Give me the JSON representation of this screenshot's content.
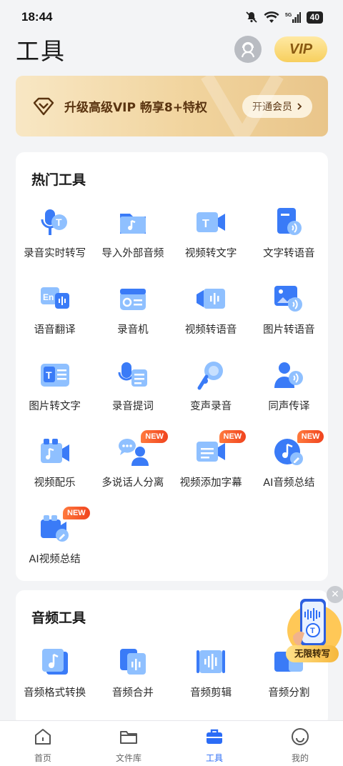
{
  "status": {
    "time": "18:44",
    "battery": "40",
    "network": "5G"
  },
  "header": {
    "title": "工具",
    "vip_label": "VIP"
  },
  "banner": {
    "text": "升级高级VIP 畅享8+特权",
    "button": "开通会员"
  },
  "hot_tools": {
    "title": "热门工具",
    "items": [
      {
        "label": "录音实时转写",
        "icon": "mic-transcribe-icon"
      },
      {
        "label": "导入外部音频",
        "icon": "import-audio-icon"
      },
      {
        "label": "视频转文字",
        "icon": "video-to-text-icon"
      },
      {
        "label": "文字转语音",
        "icon": "text-to-speech-icon"
      },
      {
        "label": "语音翻译",
        "icon": "voice-translate-icon"
      },
      {
        "label": "录音机",
        "icon": "recorder-icon"
      },
      {
        "label": "视频转语音",
        "icon": "video-to-audio-icon"
      },
      {
        "label": "图片转语音",
        "icon": "image-to-speech-icon"
      },
      {
        "label": "图片转文字",
        "icon": "image-to-text-icon"
      },
      {
        "label": "录音提词",
        "icon": "teleprompter-icon"
      },
      {
        "label": "变声录音",
        "icon": "voice-changer-icon"
      },
      {
        "label": "同声传译",
        "icon": "simultaneous-interpret-icon"
      },
      {
        "label": "视频配乐",
        "icon": "video-music-icon"
      },
      {
        "label": "多说话人分离",
        "icon": "speaker-separation-icon",
        "badge": "NEW"
      },
      {
        "label": "视频添加字幕",
        "icon": "video-subtitle-icon",
        "badge": "NEW"
      },
      {
        "label": "AI音频总结",
        "icon": "ai-audio-summary-icon",
        "badge": "NEW"
      },
      {
        "label": "AI视频总结",
        "icon": "ai-video-summary-icon",
        "badge": "NEW"
      }
    ]
  },
  "audio_tools": {
    "title": "音频工具",
    "items": [
      {
        "label": "音频格式转换",
        "icon": "audio-format-icon"
      },
      {
        "label": "音频合并",
        "icon": "audio-merge-icon"
      },
      {
        "label": "音频剪辑",
        "icon": "audio-cut-icon"
      },
      {
        "label": "音频分割",
        "icon": "audio-split-icon"
      }
    ]
  },
  "promo": {
    "label": "无限转写"
  },
  "nav": {
    "items": [
      {
        "label": "首页",
        "icon": "home-icon"
      },
      {
        "label": "文件库",
        "icon": "folder-icon"
      },
      {
        "label": "工具",
        "icon": "toolbox-icon",
        "active": true
      },
      {
        "label": "我的",
        "icon": "profile-icon"
      }
    ]
  },
  "colors": {
    "accent": "#2b6cf6",
    "icon_blue": "#3a7bf7",
    "icon_light": "#8fc0ff",
    "badge": "#f0441f",
    "vip_gold": "#f7cf5e"
  }
}
